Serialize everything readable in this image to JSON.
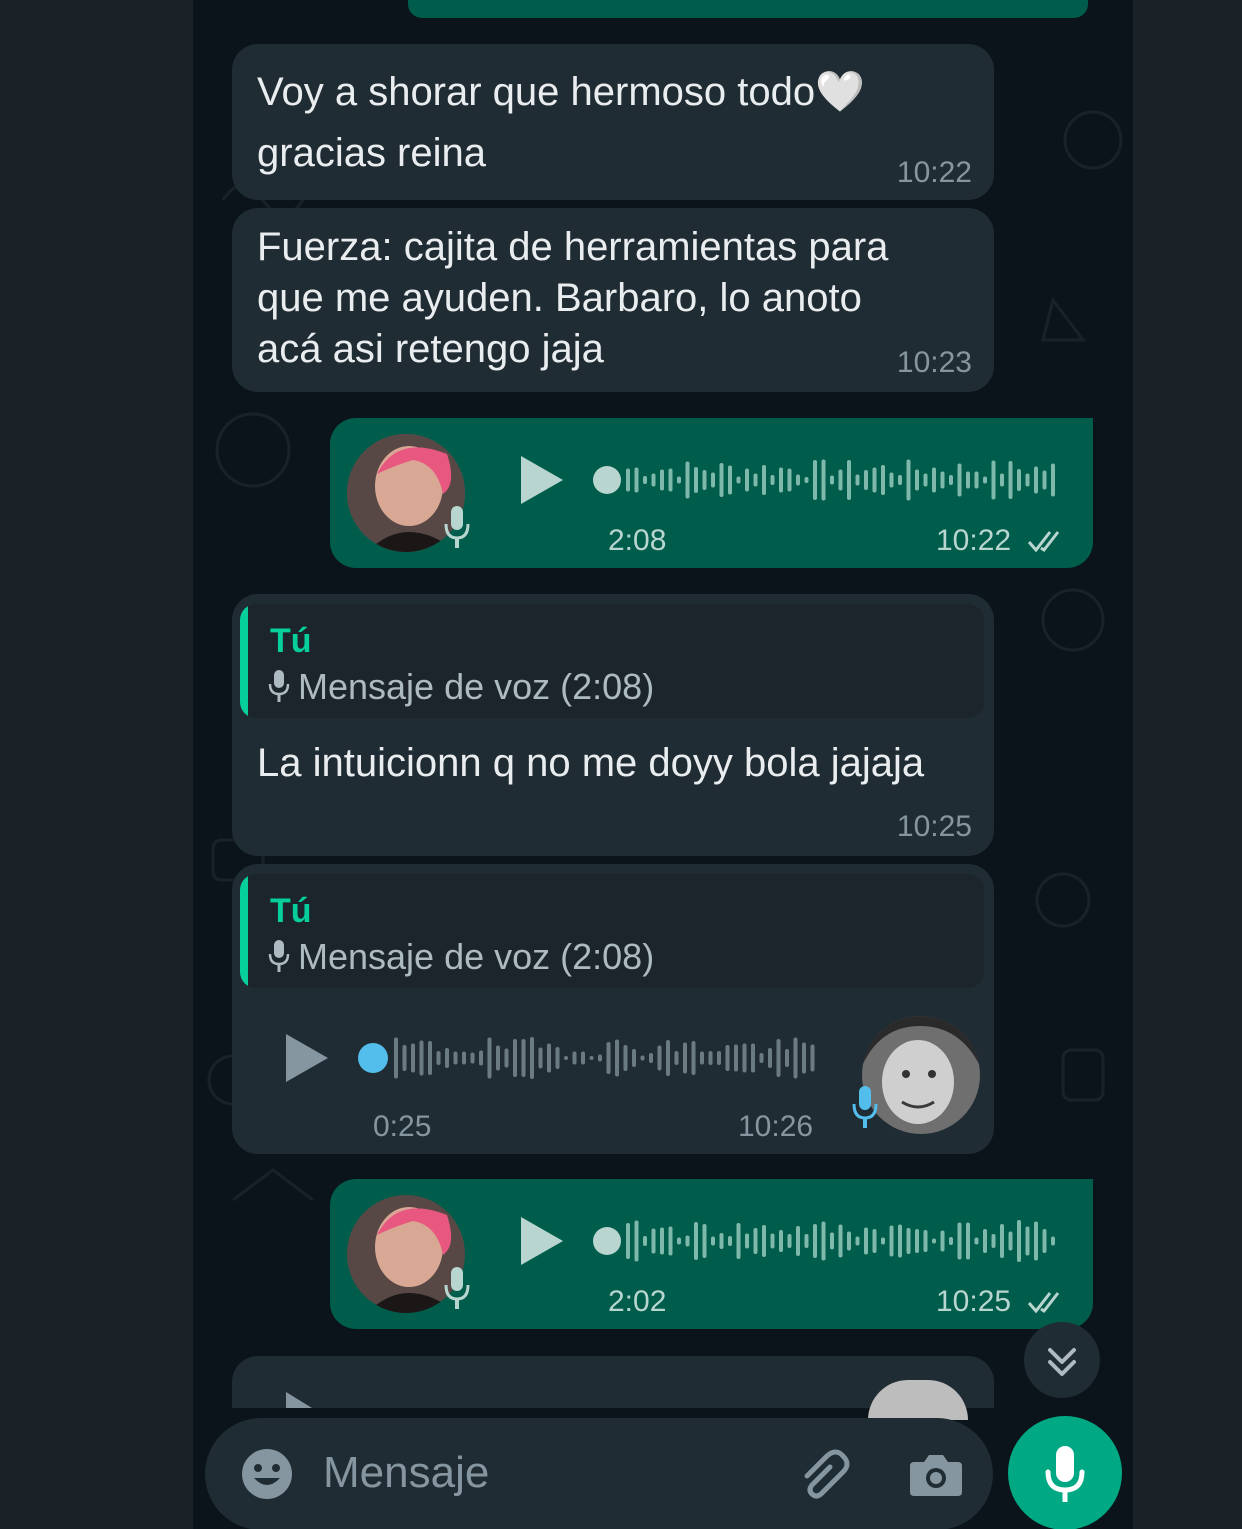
{
  "messages": [
    {
      "text_line1": "Voy a shorar que hermoso todo🤍",
      "text_line2": "gracias reina",
      "time": "10:22"
    },
    {
      "text_line1": "Fuerza: cajita de herramientas para",
      "text_line2": "que me ayuden. Barbaro, lo anoto",
      "text_line3": "acá asi retengo jaja",
      "time": "10:23"
    },
    {
      "duration": "2:08",
      "time": "10:22"
    },
    {
      "quote_author": "Tú",
      "quote_text": "Mensaje de voz (2:08)",
      "text": "La intuicionn q no me doyy bola jajaja",
      "time": "10:25"
    },
    {
      "quote_author": "Tú",
      "quote_text": "Mensaje de voz (2:08)",
      "duration": "0:25",
      "time": "10:26"
    },
    {
      "duration": "2:02",
      "time": "10:25"
    }
  ],
  "composer": {
    "placeholder": "Mensaje"
  },
  "colors": {
    "outgoing": "#005c4b",
    "incoming": "#202c33",
    "accent": "#00a884",
    "unplayed_dot": "#53bdeb"
  },
  "icons": [
    "play-icon",
    "mic-icon",
    "double-check-icon",
    "emoji-icon",
    "attach-icon",
    "camera-icon",
    "chevron-double-down-icon"
  ]
}
